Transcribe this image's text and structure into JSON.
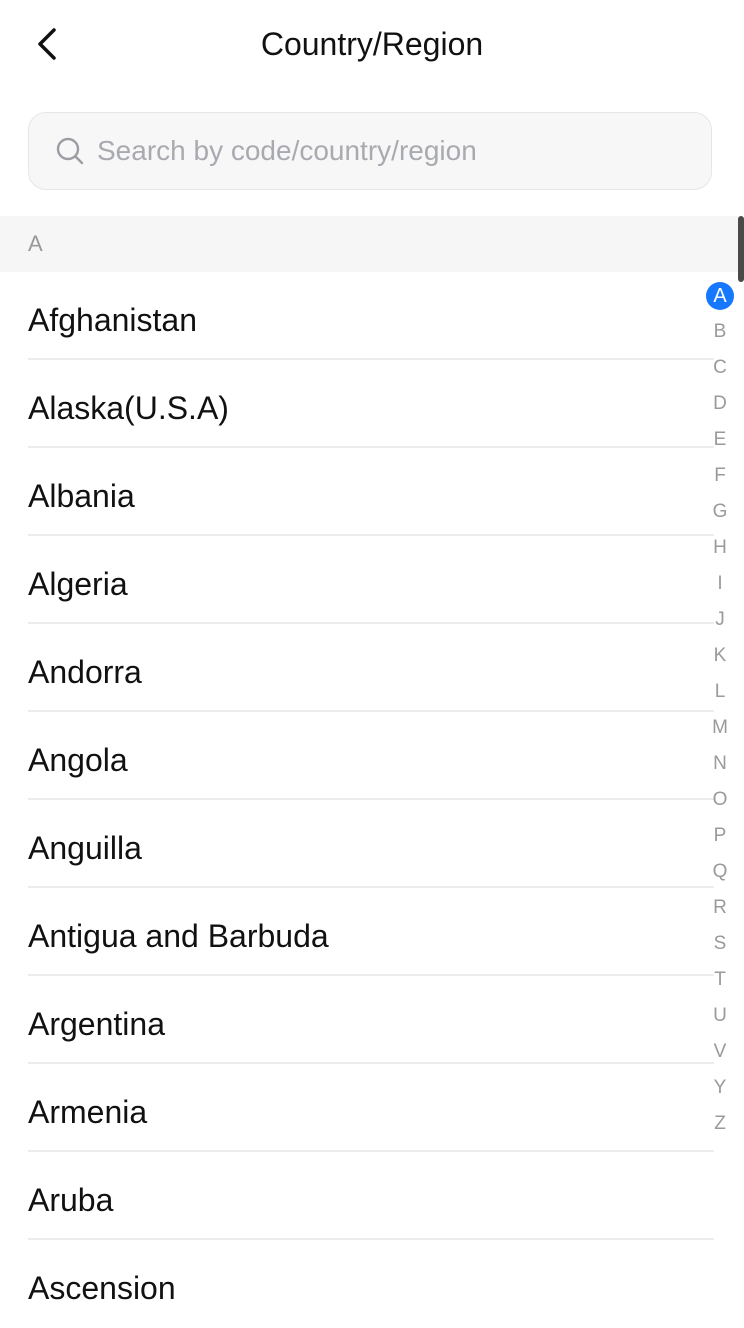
{
  "header": {
    "title": "Country/Region",
    "back_icon": "chevron-left-icon"
  },
  "search": {
    "placeholder": "Search by code/country/region",
    "value": "",
    "icon": "search-icon"
  },
  "section": {
    "letter": "A"
  },
  "countries": [
    "Afghanistan",
    "Alaska(U.S.A)",
    "Albania",
    "Algeria",
    "Andorra",
    "Angola",
    "Anguilla",
    "Antigua and Barbuda",
    "Argentina",
    "Armenia",
    "Aruba",
    "Ascension"
  ],
  "index_bar": {
    "letters": [
      "A",
      "B",
      "C",
      "D",
      "E",
      "F",
      "G",
      "H",
      "I",
      "J",
      "K",
      "L",
      "M",
      "N",
      "O",
      "P",
      "Q",
      "R",
      "S",
      "T",
      "U",
      "V",
      "Y",
      "Z"
    ],
    "active": "A",
    "active_color": "#1677ff"
  }
}
